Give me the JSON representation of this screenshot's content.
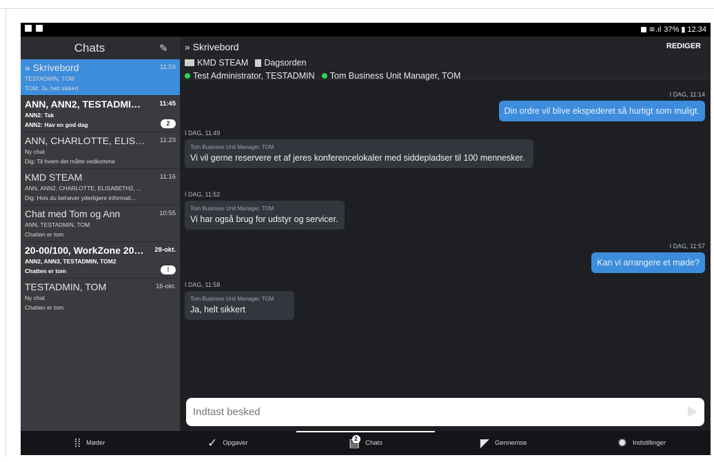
{
  "status_bar": {
    "right_text": "37% ▮ 12.34"
  },
  "sidebar": {
    "title": "Chats",
    "chats": [
      {
        "name": "» Skrivebord",
        "time": "11:59",
        "line1": "TESTADMIN, TOM",
        "line2": "TOM: Ja, helt sikkert",
        "active": true
      },
      {
        "name": "ANN, ANN2, TESTADMIN, TOM2",
        "time": "11:45",
        "line1": "ANN2: Tak",
        "line2": "ANN2: Hav en god dag",
        "badge": "2",
        "bold": true
      },
      {
        "name": "ANN, CHARLOTTE, ELISABETH,...",
        "time": "11:23",
        "line1": "Ny chat",
        "line2": "Dig: Til hvem det måtte vedkomme"
      },
      {
        "name": "KMD STEAM",
        "time": "11:16",
        "line1": "ANN, ANN2, CHARLOTTE, ELISABETH2, ...",
        "line2": "Dig: Hvis du behøver yderligere informati..."
      },
      {
        "name": "Chat med Tom og Ann",
        "time": "10:55",
        "line1": "ANN, TESTADMIN, TOM",
        "line2": "Chatten er tom"
      },
      {
        "name": "20-00/100, WorkZone 2021.0, ...",
        "time": "28-okt.",
        "line1": "ANN2, ANN3, TESTADMIN, TOM2",
        "line2": "Chatten er tom",
        "badge": "!",
        "bold": true
      },
      {
        "name": "TESTADMIN, TOM",
        "time": "16-okt.",
        "line1": "Ny chat",
        "line2": "Chatten er tom"
      }
    ]
  },
  "main": {
    "title": "» Skrivebord",
    "edit_label": "REDIGER",
    "folder": "KMD STEAM",
    "document": "Dagsorden",
    "members": [
      "Test Administrator, TESTADMIN",
      "Tom Business Unit Manager, TOM"
    ],
    "messages": [
      {
        "dir": "out",
        "time": "I DAG, 11:14",
        "text": "Din ordre vil blive ekspederet så hurtigt som muligt."
      },
      {
        "dir": "in",
        "time": "I DAG, 11:49",
        "sender": "Tom Business Unit Manager, TOM",
        "text": "Vi vil gerne reservere et af jeres konferencelokaler med siddepladser til 100 mennesker."
      },
      {
        "dir": "in",
        "time": "I DAG, 11:52",
        "sender": "Tom Business Unit Manager, TOM",
        "text": "Vi har også brug for udstyr og servicer."
      },
      {
        "dir": "out",
        "time": "I DAG, 11:57",
        "text": "Kan vi arrangere et møde?"
      },
      {
        "dir": "in",
        "time": "I DAG, 11:58",
        "sender": "Tom Business Unit Manager, TOM",
        "text": "Ja, helt sikkert"
      }
    ],
    "input_placeholder": "Indtast besked"
  },
  "bottom_nav": {
    "items": [
      {
        "label": "Møder",
        "icon": "meetings-icon"
      },
      {
        "label": "Opgaver",
        "icon": "check-icon"
      },
      {
        "label": "Chats",
        "icon": "chat-icon",
        "badge": "2",
        "active": true
      },
      {
        "label": "Gennemse",
        "icon": "browse-icon"
      },
      {
        "label": "Indstillinger",
        "icon": "gear-icon"
      }
    ]
  }
}
